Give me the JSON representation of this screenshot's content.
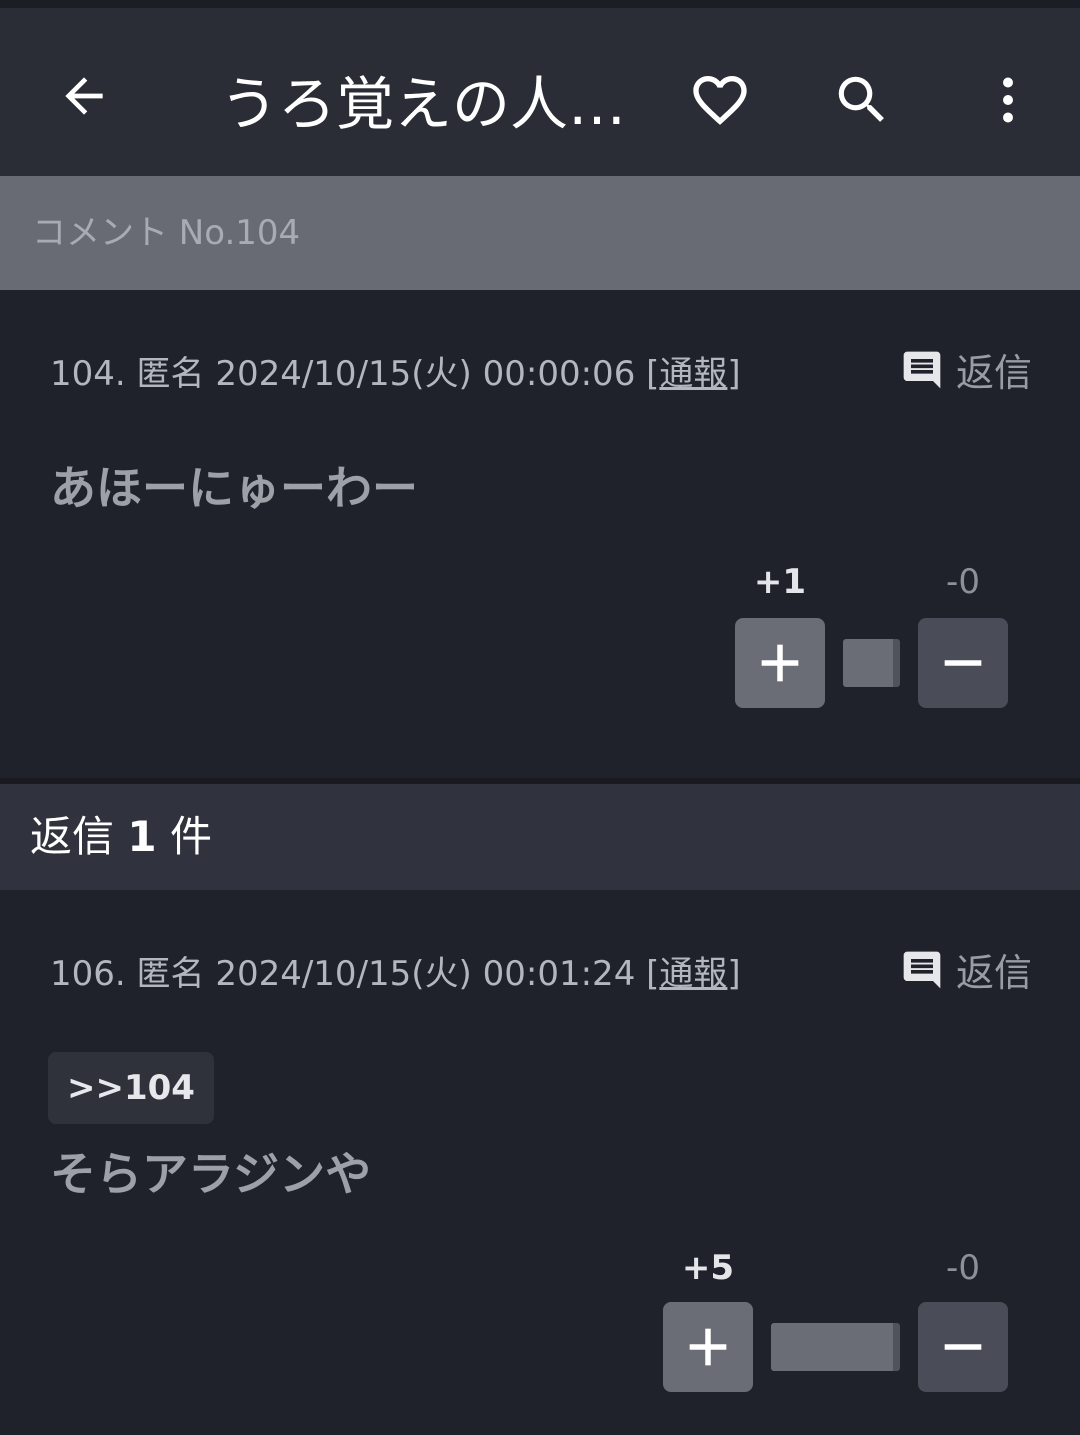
{
  "topbar": {
    "title": "うろ覚えの人…",
    "icons": [
      "back-arrow-icon",
      "heart-icon",
      "search-icon",
      "more-vert-icon"
    ]
  },
  "section": {
    "header": "コメント No.104"
  },
  "comments": [
    {
      "meta_prefix": "104. 匿名 2024/10/15(火) 00:00:06 [",
      "report": "通報",
      "meta_suffix": "]",
      "reply_label": "返信",
      "anchor": "",
      "body": "あほーにゅーわー",
      "votes": {
        "plus_label": "+1",
        "minus_label": "-0",
        "plus": 1,
        "minus": 0
      }
    },
    {
      "meta_prefix": "106. 匿名 2024/10/15(火) 00:01:24 [",
      "report": "通報",
      "meta_suffix": "]",
      "reply_label": "返信",
      "anchor": ">>104",
      "body": "そらアラジンや",
      "votes": {
        "plus_label": "+5",
        "minus_label": "-0",
        "plus": 5,
        "minus": 0
      }
    }
  ],
  "replies": {
    "prefix": "返信",
    "count": "1",
    "suffix": "件"
  },
  "colors": {
    "background": "#20222b",
    "topbar": "#2a2d36",
    "section_header": "#686b74",
    "replies_header": "#30333d"
  }
}
